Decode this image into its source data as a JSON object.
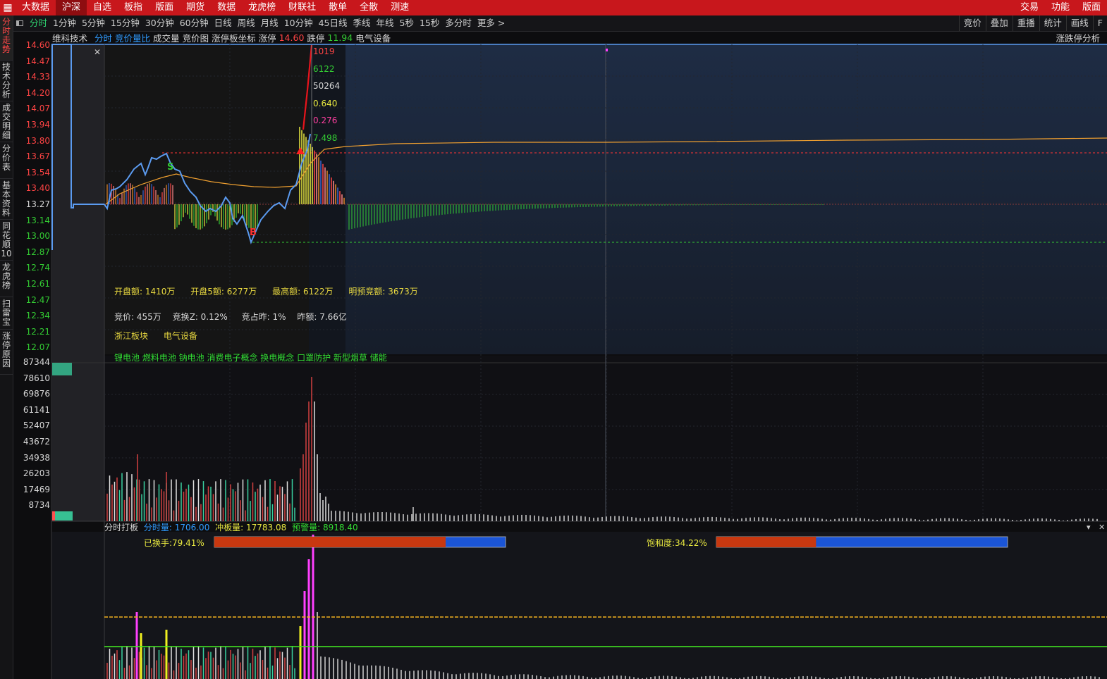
{
  "top_menu": {
    "items": [
      "大数据",
      "沪深",
      "自选",
      "板指",
      "版面",
      "期货",
      "数据",
      "龙虎榜",
      "财联社",
      "散单",
      "全散",
      "测速"
    ],
    "active": 1,
    "right_items": [
      "交易",
      "功能",
      "版面"
    ]
  },
  "period_bar": {
    "items": [
      "分时",
      "1分钟",
      "5分钟",
      "15分钟",
      "30分钟",
      "60分钟",
      "日线",
      "周线",
      "月线",
      "10分钟",
      "45日线",
      "季线",
      "年线",
      "5秒",
      "15秒",
      "多分时",
      "更多 >"
    ],
    "active": 0,
    "right_items": [
      "竞价",
      "叠加",
      "重播",
      "统计",
      "画线",
      "F"
    ]
  },
  "left_tabs": [
    {
      "label": "分时走势",
      "active": true
    },
    {
      "label": "技术分析",
      "active": false
    },
    {
      "label": "成交明细",
      "active": false
    },
    {
      "label": "分价表",
      "active": false
    },
    {
      "label": "基本资料",
      "active": false
    },
    {
      "label": "同花顺10",
      "active": false
    },
    {
      "label": "龙虎榜",
      "active": false
    },
    {
      "label": "扫雷宝",
      "active": false
    },
    {
      "label": "涨停原因",
      "active": false
    }
  ],
  "chart_header": {
    "stock_name": "维科技术",
    "tab_fenshi": "分时",
    "tab_jingjia": "竞价量比",
    "tab_volume": "成交量",
    "tab_jjt": "竞价图",
    "tab_zt": "涨停板坐标",
    "limit_up_label": "涨停",
    "limit_up_value": "14.60",
    "limit_down_label": "跌停",
    "limit_down_value": "11.94",
    "sector": "电气设备",
    "right_label": "涨跌停分析"
  },
  "price_axis": {
    "ticks": [
      {
        "v": "14.60",
        "c": "up"
      },
      {
        "v": "14.47",
        "c": "up"
      },
      {
        "v": "14.33",
        "c": "up"
      },
      {
        "v": "14.20",
        "c": "up"
      },
      {
        "v": "14.07",
        "c": "up"
      },
      {
        "v": "13.94",
        "c": "up"
      },
      {
        "v": "13.80",
        "c": "up"
      },
      {
        "v": "13.67",
        "c": "up"
      },
      {
        "v": "13.54",
        "c": "up"
      },
      {
        "v": "13.40",
        "c": "up"
      },
      {
        "v": "13.27",
        "c": "flat"
      },
      {
        "v": "13.14",
        "c": "down"
      },
      {
        "v": "13.00",
        "c": "down"
      },
      {
        "v": "12.87",
        "c": "down"
      },
      {
        "v": "12.74",
        "c": "down"
      },
      {
        "v": "12.61",
        "c": "down"
      },
      {
        "v": "12.47",
        "c": "down"
      },
      {
        "v": "12.34",
        "c": "down"
      },
      {
        "v": "12.21",
        "c": "down"
      },
      {
        "v": "12.07",
        "c": "down"
      }
    ]
  },
  "volume_axis": [
    "87344",
    "78610",
    "69876",
    "61141",
    "52407",
    "43672",
    "34938",
    "26203",
    "17469",
    "8734"
  ],
  "tooltip_values": [
    {
      "v": "1019",
      "color": "#ff4444"
    },
    {
      "v": "6122",
      "color": "#33cc33"
    },
    {
      "v": "50264",
      "color": "#d8d8d8"
    },
    {
      "v": "0.640",
      "color": "#e8e840"
    },
    {
      "v": "0.276",
      "color": "#ff3fa0"
    },
    {
      "v": "7.498",
      "color": "#33cc33"
    }
  ],
  "markers": {
    "sell": "S",
    "buy": "B"
  },
  "info": {
    "line1": [
      "开盘额: 1410万",
      "开盘5额: 6277万",
      "最高额: 6122万",
      "明预竞额: 3673万"
    ],
    "line2": [
      "竞价: 455万",
      "竞换Z: 0.12%",
      "竞占昨: 1%",
      "昨额: 7.66亿"
    ],
    "line3": [
      "浙江板块",
      "电气设备"
    ],
    "concepts": "锂电池 燃料电池 钠电池 消费电子概念 换电概念 口罩防护 新型烟草 储能"
  },
  "bottom_panel": {
    "title": "分时打板",
    "fsl_label": "分时量: 1706.00",
    "cbl_label": "冲板量: 17783.08",
    "yjl_label": "预警量: 8918.40",
    "turnover_label": "已换手:79.41%",
    "turnover_value": 0.7941,
    "saturation_label": "饱和度:34.22%",
    "saturation_value": 0.3422
  },
  "colors": {
    "up": "#ff4444",
    "down": "#33cc33",
    "price_line": "#5b9bf0",
    "avg_line": "#f0a030",
    "accent_red": "#c8171c"
  }
}
